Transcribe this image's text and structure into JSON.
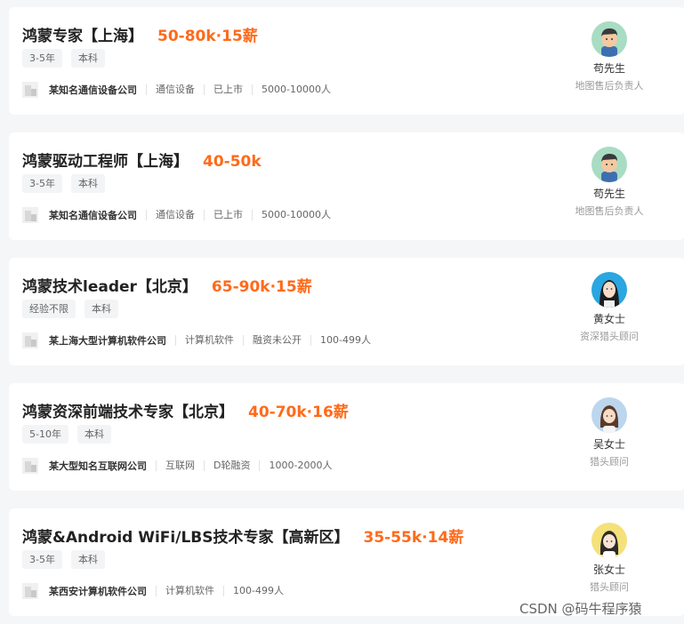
{
  "jobs": [
    {
      "title": "鸿蒙专家【上海】",
      "salary": "50-80k·15薪",
      "tags": [
        "3-5年",
        "本科"
      ],
      "company": "某知名通信设备公司",
      "meta": [
        "通信设备",
        "已上市",
        "5000-10000人"
      ],
      "recruiter": {
        "name": "苟先生",
        "title": "地图售后负责人",
        "avatar": "male-cartoon-avatar",
        "avatar_bg": "#a8dcc3"
      }
    },
    {
      "title": "鸿蒙驱动工程师【上海】",
      "salary": "40-50k",
      "tags": [
        "3-5年",
        "本科"
      ],
      "company": "某知名通信设备公司",
      "meta": [
        "通信设备",
        "已上市",
        "5000-10000人"
      ],
      "recruiter": {
        "name": "苟先生",
        "title": "地图售后负责人",
        "avatar": "male-cartoon-avatar",
        "avatar_bg": "#a8dcc3"
      }
    },
    {
      "title": "鸿蒙技术leader【北京】",
      "salary": "65-90k·15薪",
      "tags": [
        "经验不限",
        "本科"
      ],
      "company": "某上海大型计算机软件公司",
      "meta": [
        "计算机软件",
        "融资未公开",
        "100-499人"
      ],
      "recruiter": {
        "name": "黄女士",
        "title": "资深猎头顾问",
        "avatar": "female-photo-avatar",
        "avatar_bg": "#2aa6e0"
      }
    },
    {
      "title": "鸿蒙资深前端技术专家【北京】",
      "salary": "40-70k·16薪",
      "tags": [
        "5-10年",
        "本科"
      ],
      "company": "某大型知名互联网公司",
      "meta": [
        "互联网",
        "D轮融资",
        "1000-2000人"
      ],
      "recruiter": {
        "name": "吴女士",
        "title": "猎头顾问",
        "avatar": "female-cartoon-avatar",
        "avatar_bg": "#bcd6ee"
      }
    },
    {
      "title": "鸿蒙&Android WiFi/LBS技术专家【高新区】",
      "salary": "35-55k·14薪",
      "tags": [
        "3-5年",
        "本科"
      ],
      "company": "某西安计算机软件公司",
      "meta": [
        "计算机软件",
        "100-499人"
      ],
      "recruiter": {
        "name": "张女士",
        "title": "猎头顾问",
        "avatar": "female-cartoon-avatar",
        "avatar_bg": "#f4e17a"
      }
    }
  ],
  "watermark": "CSDN @码牛程序猿"
}
